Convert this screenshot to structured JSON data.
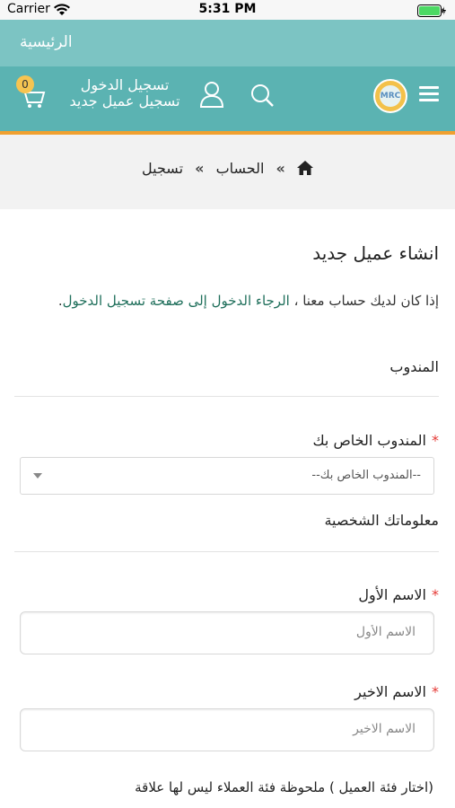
{
  "status_bar": {
    "carrier": "Carrier",
    "time": "5:31 PM"
  },
  "header": {
    "home_title": "الرئيسية",
    "cart_count": "0",
    "login_link": "تسجيل الدخول",
    "register_link": "تسجيل عميل جديد"
  },
  "breadcrumb": {
    "account": "الحساب",
    "register": "تسجيل",
    "separator": "»"
  },
  "page": {
    "title": "انشاء عميل جديد",
    "note_prefix": "إذا كان لديك حساب معنا ، ",
    "note_link": "الرجاء الدخول إلى صفحة تسجيل الدخول",
    "note_suffix": "."
  },
  "sections": {
    "agent": "المندوب",
    "personal": "معلوماتك الشخصية"
  },
  "fields": {
    "agent": {
      "label": "المندوب الخاص بك",
      "required_mark": "*",
      "selected": "--المندوب الخاص بك--"
    },
    "first_name": {
      "label": "الاسم الأول",
      "required_mark": "*",
      "placeholder": "الاسم الأول",
      "value": ""
    },
    "last_name": {
      "label": "الاسم الاخير",
      "required_mark": "*",
      "placeholder": "الاسم الاخير",
      "value": ""
    }
  },
  "customer_group_note": "(اختار فئة العميل ) ملحوظة فئة العملاء ليس لها علاقة",
  "colors": {
    "topbar": "#7cc4c3",
    "navbar": "#5bb3b2",
    "accent_line": "#f0a030",
    "required": "#e53935",
    "link": "#1f6f5b"
  }
}
